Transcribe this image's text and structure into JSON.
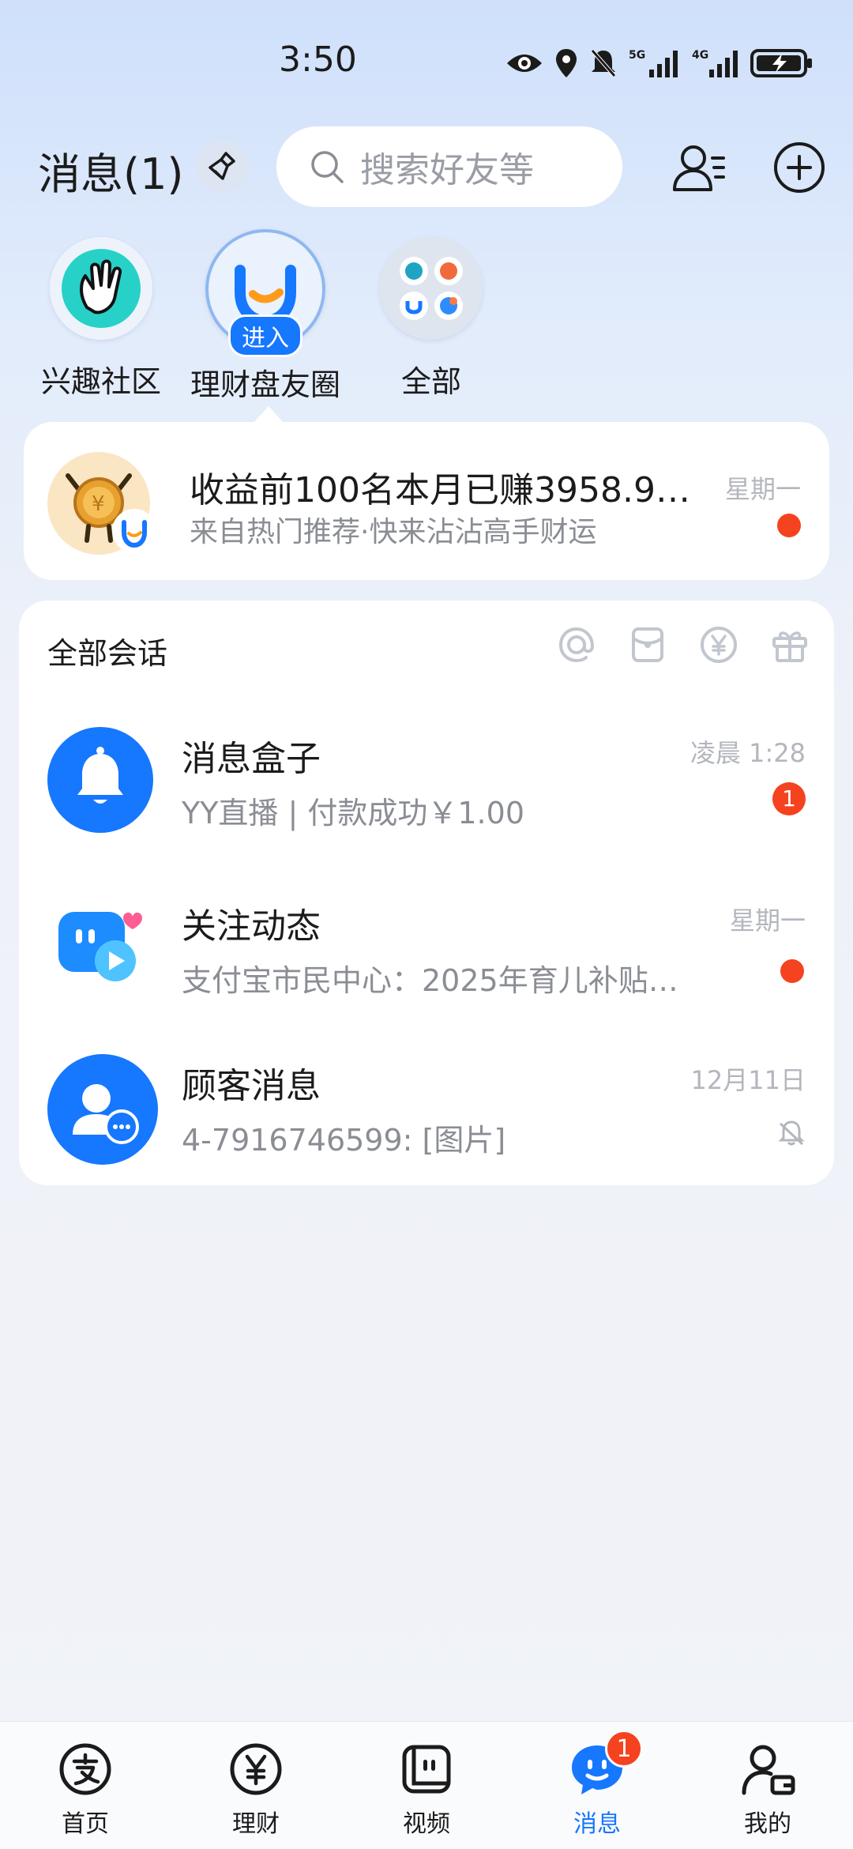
{
  "status_bar": {
    "time": "3:50",
    "net1": "5G",
    "net2": "4G"
  },
  "header": {
    "title": "消息(1)",
    "search_placeholder": "搜索好友等"
  },
  "quick_items": [
    {
      "label": "兴趣社区"
    },
    {
      "label": "理财盘友圈",
      "badge": "进入"
    },
    {
      "label": "全部"
    }
  ],
  "promo": {
    "title": "收益前100名本月已赚3958.9…",
    "subtitle": "来自热门推荐·快来沾沾高手财运",
    "time": "星期一"
  },
  "conversations": {
    "header": "全部会话",
    "items": [
      {
        "name": "消息盒子",
        "preview": "YY直播 | 付款成功￥1.00",
        "time": "凌晨 1:28",
        "badge": "1"
      },
      {
        "name": "关注动态",
        "preview": "支付宝市民中心：2025年育儿补贴…",
        "time": "星期一"
      },
      {
        "name": "顾客消息",
        "preview": "4-7916746599: [图片]",
        "time": "12月11日"
      }
    ]
  },
  "bottom_nav": [
    {
      "label": "首页"
    },
    {
      "label": "理财"
    },
    {
      "label": "视频"
    },
    {
      "label": "消息",
      "badge": "1"
    },
    {
      "label": "我的"
    }
  ],
  "colors": {
    "accent": "#1677ff",
    "alert": "#f5421f"
  }
}
